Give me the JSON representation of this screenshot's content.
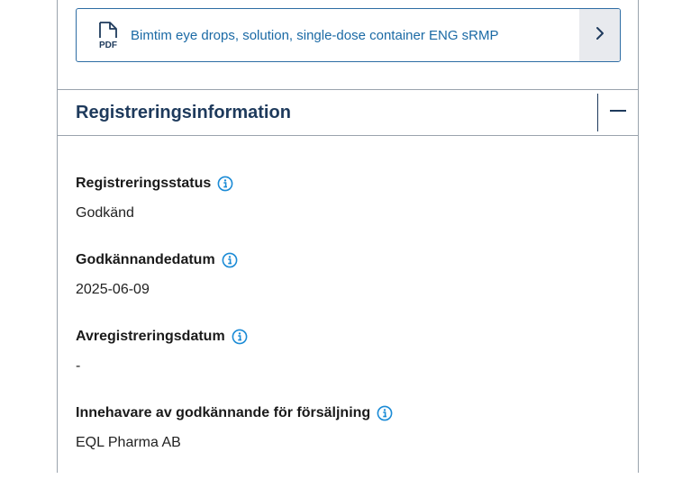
{
  "document": {
    "link_text": "Bimtim eye drops, solution, single-dose container ENG sRMP",
    "icon": "pdf-file-icon",
    "arrow_icon": "chevron-right-icon"
  },
  "section": {
    "title": "Registreringsinformation",
    "collapse_icon": "minus-icon"
  },
  "fields": [
    {
      "label": "Registreringsstatus",
      "value": "Godkänd"
    },
    {
      "label": "Godkännandedatum",
      "value": "2025-06-09"
    },
    {
      "label": "Avregistreringsdatum",
      "value": "-"
    },
    {
      "label": "Innehavare av godkännande för försäljning",
      "value": "EQL Pharma AB"
    }
  ],
  "colors": {
    "link": "#1b6aa5",
    "heading": "#1e3a5c",
    "info_icon": "#1b8bd6",
    "border": "#9aa3ad"
  }
}
